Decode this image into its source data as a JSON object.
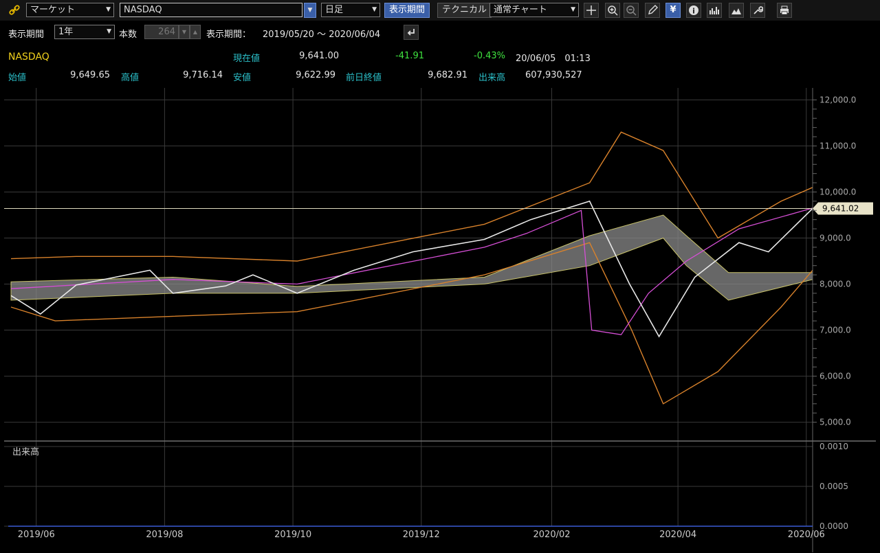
{
  "toolbar": {
    "market_select": "マーケット",
    "symbol_input": "NASDAQ",
    "interval_select": "日足",
    "period_button": "表示期間",
    "technical_button": "テクニカル",
    "charttype_select": "通常チャート",
    "yen_label": "¥",
    "info_label": "i"
  },
  "period_bar": {
    "period_label": "表示期間",
    "period_select": "1年",
    "count_label": "本数",
    "count_value": "264",
    "range_label": "表示期間：",
    "range_value": "2019/05/20 ～ 2020/06/04"
  },
  "quote": {
    "symbol": "NASDAQ",
    "current_label": "現在値",
    "current_value": "9,641.00",
    "change": "-41.91",
    "change_pct": "-0.43%",
    "datetime": "20/06/05　01:13",
    "open_label": "始値",
    "open_value": "9,649.65",
    "high_label": "高値",
    "high_value": "9,716.14",
    "low_label": "安値",
    "low_value": "9,622.99",
    "prev_label": "前日終値",
    "prev_value": "9,682.91",
    "volume_label": "出来高",
    "volume_value": "607,930,527"
  },
  "colors": {
    "accent_blue": "#3a5fa8",
    "label_cyan": "#2bbfc9",
    "positive_green": "#3fe23f",
    "symbol_yellow": "#f2d21c",
    "candle_up": "#eaeaea",
    "candle_down": "#e03a3a"
  },
  "chart_data": {
    "type": "line",
    "price_tag": "9,641.02",
    "current_price": 9641.02,
    "ylim": [
      4800,
      12200
    ],
    "y_ticks": [
      "12,000.0",
      "11,000.0",
      "10,000.0",
      "9,000.0",
      "8,000.0",
      "7,000.0",
      "6,000.0",
      "5,000.0"
    ],
    "y_tick_values": [
      12000,
      11000,
      10000,
      9000,
      8000,
      7000,
      6000,
      5000
    ],
    "volume_label": "出来高",
    "volume_ticks": [
      "0.0010",
      "0.0005",
      "0.0000"
    ],
    "x_ticks": [
      "2019/06",
      "2019/08",
      "2019/10",
      "2019/12",
      "2020/02",
      "2020/04",
      "2020/06"
    ],
    "close_series": {
      "name": "",
      "x": [
        "2019/05/20",
        "2019/06/03",
        "2019/06/20",
        "2019/07/25",
        "2019/08/05",
        "2019/08/30",
        "2019/09/12",
        "2019/10/03",
        "2019/10/30",
        "2019/11/27",
        "2019/12/31",
        "2020/01/22",
        "2020/02/19",
        "2020/03/09",
        "2020/03/23",
        "2020/04/09",
        "2020/04/30",
        "2020/05/14",
        "2020/06/04"
      ],
      "y": [
        7750,
        7350,
        7980,
        8300,
        7800,
        7960,
        8200,
        7800,
        8300,
        8700,
        8970,
        9400,
        9800,
        8000,
        6860,
        8150,
        8900,
        8700,
        9641
      ]
    },
    "upper_band_outer": {
      "x": [
        "2019/05/20",
        "2019/06/20",
        "2019/08/05",
        "2019/10/03",
        "2019/12/31",
        "2020/02/19",
        "2020/03/05",
        "2020/03/25",
        "2020/04/20",
        "2020/05/20",
        "2020/06/04"
      ],
      "y": [
        8550,
        8600,
        8600,
        8500,
        9300,
        10200,
        11300,
        10900,
        9000,
        9800,
        10100
      ]
    },
    "lower_band_outer": {
      "x": [
        "2019/05/20",
        "2019/06/10",
        "2019/08/05",
        "2019/10/03",
        "2019/12/31",
        "2020/02/19",
        "2020/03/10",
        "2020/03/25",
        "2020/04/20",
        "2020/05/20",
        "2020/06/04"
      ],
      "y": [
        7500,
        7200,
        7300,
        7400,
        8200,
        8900,
        7000,
        5400,
        6100,
        7500,
        8300
      ]
    },
    "cloud_top": {
      "x": [
        "2019/05/20",
        "2019/08/05",
        "2019/10/03",
        "2019/12/31",
        "2020/02/19",
        "2020/03/25",
        "2020/04/05",
        "2020/04/25",
        "2020/06/04"
      ],
      "y": [
        8050,
        8150,
        7950,
        8150,
        9050,
        9500,
        9050,
        8250,
        8250
      ]
    },
    "cloud_bottom": {
      "x": [
        "2019/05/20",
        "2019/08/05",
        "2019/10/03",
        "2019/12/31",
        "2020/02/19",
        "2020/03/25",
        "2020/04/05",
        "2020/04/25",
        "2020/06/04"
      ],
      "y": [
        7650,
        7800,
        7800,
        8000,
        8400,
        9000,
        8400,
        7650,
        8100
      ]
    },
    "oscillator": {
      "x": [
        "2019/05/20",
        "2019/08/05",
        "2019/10/03",
        "2019/12/31",
        "2020/01/20",
        "2020/02/15",
        "2020/02/20",
        "2020/03/05",
        "2020/03/18",
        "2020/04/05",
        "2020/04/30",
        "2020/06/04"
      ],
      "y": [
        7900,
        8100,
        8000,
        8800,
        9100,
        9600,
        7000,
        6900,
        7800,
        8500,
        9200,
        9650
      ]
    }
  }
}
